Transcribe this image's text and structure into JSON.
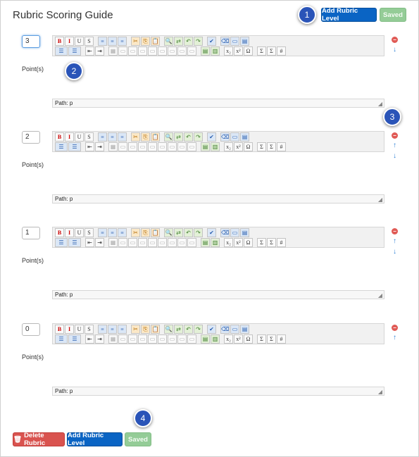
{
  "page_title": "Rubric Scoring Guide",
  "header": {
    "add_level_label": "Add Rubric Level",
    "saved_label": "Saved"
  },
  "callouts": [
    "1",
    "2",
    "3",
    "4"
  ],
  "levels": [
    {
      "points": "3",
      "points_label": "Point(s)",
      "path_label": "Path: p",
      "has_remove": true,
      "has_up": false,
      "has_down": true
    },
    {
      "points": "2",
      "points_label": "Point(s)",
      "path_label": "Path: p",
      "has_remove": true,
      "has_up": true,
      "has_down": true
    },
    {
      "points": "1",
      "points_label": "Point(s)",
      "path_label": "Path: p",
      "has_remove": true,
      "has_up": true,
      "has_down": true
    },
    {
      "points": "0",
      "points_label": "Point(s)",
      "path_label": "Path: p",
      "has_remove": true,
      "has_up": true,
      "has_down": false
    }
  ],
  "toolbar": {
    "row1": [
      "B",
      "I",
      "U",
      "S",
      "≡",
      "≡",
      "≡",
      "✂",
      "⎘",
      "📋",
      "🔍",
      "⇄",
      "↶",
      "↷",
      "✔",
      "⌫",
      "▭",
      "▤"
    ],
    "row2": [
      "☰",
      "☰",
      "⇤",
      "⇥",
      "▦",
      "▭",
      "▭",
      "▭",
      "▭",
      "▭",
      "▭",
      "▭",
      "▭",
      "▤",
      "▥",
      "x₂",
      "x²",
      "Ω",
      "Σ",
      "Σ",
      "#"
    ]
  },
  "icons": {
    "remove": "minus-circle-icon",
    "up": "arrow-up-icon",
    "down": "arrow-down-icon",
    "trash": "trash-icon"
  },
  "footer": {
    "delete_label": "Delete Rubric",
    "add_level_label": "Add Rubric Level",
    "saved_label": "Saved"
  },
  "colors": {
    "primary": "#0a64c4",
    "success": "#94cc97",
    "danger": "#d9534f",
    "callout": "#2a54b8"
  }
}
